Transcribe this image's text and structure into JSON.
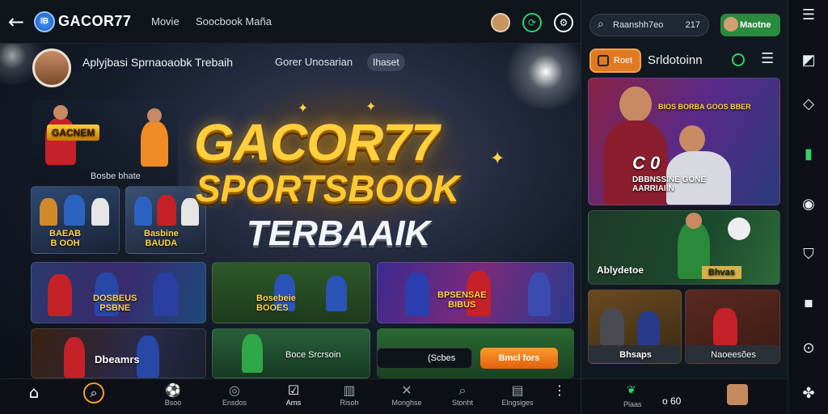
{
  "header": {
    "back_icon": "arrow-left-icon",
    "logo_badge": "IB",
    "logo_text": "GACOR77",
    "nav": [
      "Movie",
      "Soocbook Maña"
    ],
    "icons": [
      "avatar-icon",
      "refresh-icon",
      "settings-icon"
    ]
  },
  "hero": {
    "title": "Aplyjbasi Sprnaoaobk Trebaih",
    "tab": "Gorer Unosarian",
    "chip": "Ihaset",
    "headline_1": "GACOR77",
    "headline_2": "SPORTSBOOK",
    "headline_3": "TERBAAIK",
    "cards": [
      {
        "label": "GACNEM"
      },
      {
        "label": "Bosbe bhate"
      },
      {
        "label": "BAEAB\nB OOH"
      },
      {
        "label": "Basbine\nBAUDA"
      },
      {
        "label": "DOSBEUS\nPSBNE"
      },
      {
        "label": "Bosebeie\nBOOES"
      },
      {
        "label": "BPSENSAE\nBIBUS"
      },
      {
        "label": "Dbeamrs"
      },
      {
        "label": "Boce Srcrsoin"
      }
    ],
    "btn_dark": "(Scbes",
    "btn_orange": "Bmcl fors"
  },
  "bottom_nav": [
    {
      "icon": "home-icon",
      "label": ""
    },
    {
      "icon": "search-icon",
      "label": ""
    },
    {
      "icon": "ball-icon",
      "label": "Bsoo"
    },
    {
      "icon": "globe-icon",
      "label": "Ensdos"
    },
    {
      "icon": "check-icon",
      "label": "Arns"
    },
    {
      "icon": "chart-icon",
      "label": "Risoh"
    },
    {
      "icon": "tools-icon",
      "label": "Monghse"
    },
    {
      "icon": "search-icon",
      "label": "Stonht"
    },
    {
      "icon": "ticket-icon",
      "label": "Elngsiges"
    },
    {
      "icon": "more-icon",
      "label": ""
    }
  ],
  "right": {
    "search_text": "Raanshh7eo",
    "search_num": "217",
    "member_label": "Maotne",
    "tab_active": "Roet",
    "title": "Srldotoinn",
    "cards": [
      {
        "label": "BIOS BORBA GOOS BBER",
        "sub": "C 0",
        "caption": "DBBNSSINE GONE\nAARRIAIIN"
      },
      {
        "label": "Ablydetoe",
        "sub": "Bhvas"
      },
      {
        "label": "Bhsaps"
      },
      {
        "label": "Naoeesões"
      }
    ],
    "bottom": [
      "Plaas",
      "o 60"
    ]
  },
  "rail": {
    "icons": [
      "menu-icon",
      "bookmark-icon",
      "tag-icon",
      "trophy-icon",
      "location-icon",
      "shield-icon",
      "square-icon",
      "clock-icon",
      "share-icon"
    ]
  },
  "colors": {
    "accent": "#e07a22",
    "gold": "#ffcf3d",
    "green": "#2a8a3e"
  }
}
